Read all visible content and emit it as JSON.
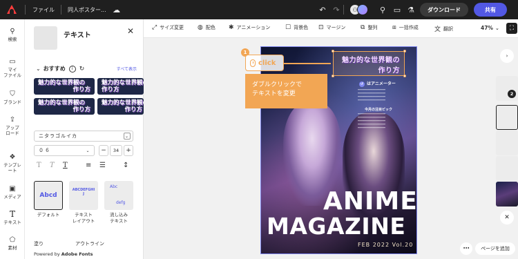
{
  "topbar": {
    "menu_file": "ファイル",
    "doc_title": "同人ポスター...",
    "download_label": "ダウンロード",
    "share_label": "共有"
  },
  "rail": {
    "items": [
      {
        "label": "検索",
        "icon": "search-icon"
      },
      {
        "label": "マイ\nファイル",
        "icon": "folder-icon"
      },
      {
        "label": "ブランド",
        "icon": "brand-icon"
      },
      {
        "label": "アップ\nロード",
        "icon": "upload-icon"
      },
      {
        "label": "テンプレ\nート",
        "icon": "template-icon"
      },
      {
        "label": "メディア",
        "icon": "media-icon"
      },
      {
        "label": "テキスト",
        "icon": "text-icon"
      },
      {
        "label": "素材",
        "icon": "elements-icon"
      }
    ]
  },
  "panel": {
    "title": "テキスト",
    "recommended_title": "おすすめ",
    "see_all": "すべて表示",
    "presets": [
      {
        "line1": "魅力的な世界観の",
        "line2": "作り方"
      },
      {
        "line1": "魅力的な世界観の",
        "line2": "作り方"
      },
      {
        "line1": "魅力的な世界観の",
        "line2": "作り方"
      },
      {
        "line1": "魅力的な世界観の",
        "line2": "作り方"
      }
    ],
    "font_name": "ニタラゴルイカ",
    "font_weight": "０６",
    "font_size": "34",
    "style_defaults": {
      "default_label": "デフォルト",
      "layout_label": "テキスト\nレイアウト",
      "flow_label": "流し込み\nテキスト",
      "default_sample": "Abcd",
      "flow_sample_1": "Abc",
      "flow_sample_2": "defg",
      "layout_sample": "ABCDEFGHIJ"
    },
    "fill_label": "塗り",
    "outline_label": "アウトライン",
    "powered_prefix": "Powered by",
    "powered_brand": "Adobe Fonts"
  },
  "ctx_toolbar": {
    "resize": "サイズ変更",
    "color": "配色",
    "animation": "アニメーション",
    "background": "背景色",
    "margin": "マージン",
    "arrange": "整列",
    "bulk_create": "一括作成",
    "translate": "翻訳",
    "zoom": "47%"
  },
  "poster": {
    "headline_line1": "魅力的な世界観の",
    "headline_line2": "作り方",
    "animator": "はアニメーター",
    "pick_title": "今月の注目ピック",
    "anime_word": "ANIME",
    "magazine_word": "MAGAZINE",
    "issue": "FEB 2022 Vol.20"
  },
  "overlay": {
    "step_number": "1",
    "click_label": "click",
    "tooltip_line1": "ダブルクリックで",
    "tooltip_line2": "テキストを変更"
  },
  "pages": {
    "count_badge": "2",
    "add_page": "ページを追加"
  },
  "colors": {
    "accent": "#5258e4",
    "highlight": "#f2a654",
    "topbar": "#1f1f1f"
  }
}
